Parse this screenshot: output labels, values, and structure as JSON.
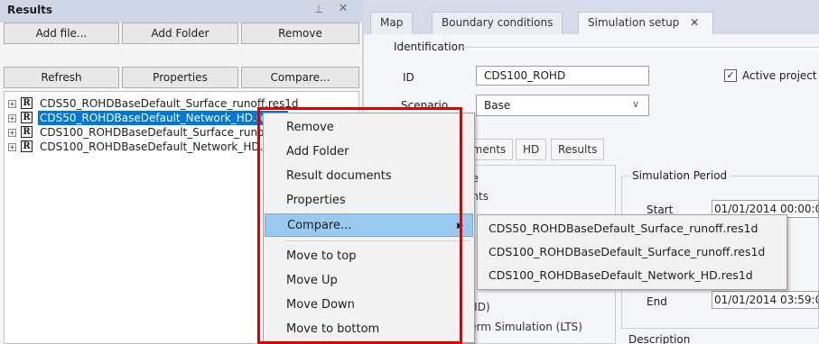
{
  "results_panel": {
    "title": "Results",
    "pin_icon": "pin-icon",
    "close_icon": "close-icon",
    "buttons": [
      "Add file...",
      "Add Folder",
      "Remove",
      "Refresh",
      "Properties",
      "Compare..."
    ],
    "tree": [
      {
        "text": "CDS50_ROHDBaseDefault_Surface_runoff.res1d",
        "selected": false
      },
      {
        "text": "CDS50_ROHDBaseDefault_Network_HD.res1d",
        "selected": true
      },
      {
        "text": "CDS100_ROHDBaseDefault_Surface_runoff.res1d",
        "selected": false
      },
      {
        "text": "CDS100_ROHDBaseDefault_Network_HD.res1d",
        "selected": false
      }
    ]
  },
  "tabs": [
    "Map",
    "Boundary conditions",
    "Simulation setup"
  ],
  "tab_close": "✕",
  "identification": {
    "group_label": "Identification",
    "id_label": "ID",
    "id_value": "CDS100_ROHD",
    "active_label": "Active project",
    "active_checked": "✓",
    "scenario_label": "Scenario",
    "scenario_value": "Base"
  },
  "subtabs": [
    "Catchments",
    "HD",
    "Results"
  ],
  "left_group": {
    "lines": [
      "pe",
      "ents",
      "(HD)",
      "Term Simulation (LTS)"
    ]
  },
  "simulation_period": {
    "label": "Simulation Period",
    "start_label": "Start",
    "start_value": "01/01/2014 00:00:0",
    "end_label": "End",
    "end_value": "01/01/2014 03:59:0",
    "description_label": "Description"
  },
  "context_menu": {
    "items": [
      "Remove",
      "Add Folder",
      "Result documents",
      "Properties",
      "Compare...",
      "Move to top",
      "Move Up",
      "Move Down",
      "Move to bottom"
    ],
    "highlighted": "Compare..."
  },
  "submenu": {
    "items": [
      "CDS50_ROHDBaseDefault_Surface_runoff.res1d",
      "CDS100_ROHDBaseDefault_Surface_runoff.res1d",
      "CDS100_ROHDBaseDefault_Network_HD.res1d"
    ]
  },
  "colors": {
    "selection": "#0078d7",
    "menu_highlight": "#99c9ef",
    "annotation": "#e00000"
  }
}
